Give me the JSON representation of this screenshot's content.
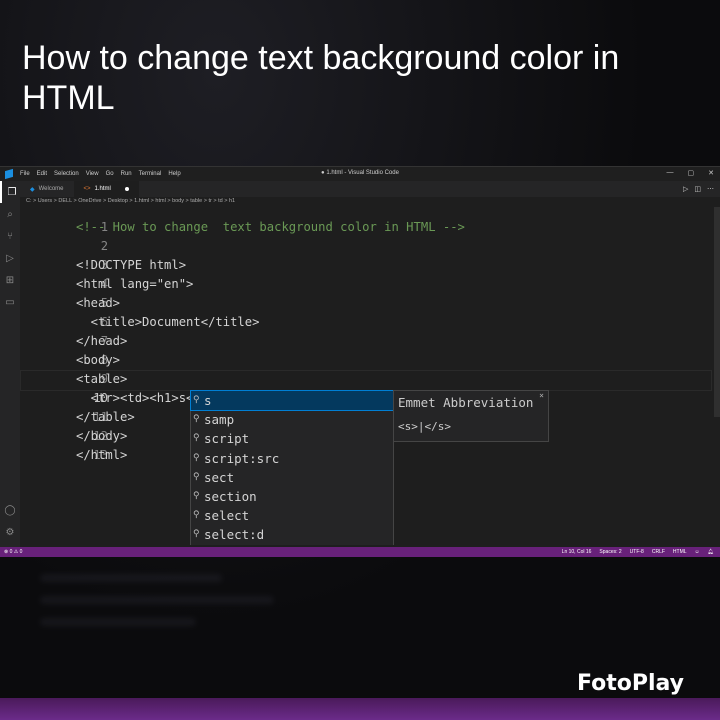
{
  "video": {
    "title": "How  to change text background color in HTML",
    "watermark": "FotoPlay"
  },
  "window": {
    "title": "● 1.html - Visual Studio Code",
    "menu": [
      "File",
      "Edit",
      "Selection",
      "View",
      "Go",
      "Run",
      "Terminal",
      "Help"
    ],
    "controls": [
      "—",
      "▢",
      "✕"
    ]
  },
  "tabs": [
    {
      "label": "Welcome",
      "icon": "vscode-icon"
    },
    {
      "label": "1.html",
      "icon": "html-icon",
      "modified": true
    }
  ],
  "breadcrumb": "C: > Users > DELL > OneDrive > Desktop > 1.html > html > body > table > tr > td > h1",
  "editor": {
    "current_line": 10,
    "lines": [
      {
        "n": "1",
        "text": "<!-- How to change  text background color in HTML -->"
      },
      {
        "n": "2",
        "text": ""
      },
      {
        "n": "3",
        "text": "<!DOCTYPE html>"
      },
      {
        "n": "4",
        "text": "<html lang=\"en\">"
      },
      {
        "n": "5",
        "text": "<head>"
      },
      {
        "n": "6",
        "text": "  <title>Document</title>"
      },
      {
        "n": "7",
        "text": "</head>"
      },
      {
        "n": "8",
        "text": "<body>"
      },
      {
        "n": "9",
        "text": "<table>"
      },
      {
        "n": "10",
        "text": "  <tr><td><h1>s</h1></td></tr>"
      },
      {
        "n": "11",
        "text": "</table>"
      },
      {
        "n": "12",
        "text": "</body>"
      },
      {
        "n": "13",
        "text": "</html>"
      }
    ]
  },
  "suggest": {
    "items": [
      "s",
      "samp",
      "script",
      "script:src",
      "sect",
      "section",
      "select",
      "select:d"
    ],
    "selected_index": 0
  },
  "details": {
    "header": "Emmet Abbreviation",
    "content": "<s>|</s>",
    "close": "×"
  },
  "statusbar": {
    "left": "⊗ 0 ⚠ 0",
    "position": "Ln 10, Col 16",
    "spaces": "Spaces: 2",
    "encoding": "UTF-8",
    "eol": "CRLF",
    "language": "HTML"
  },
  "colors": {
    "accent": "#007fd4",
    "statusbar": "#68217a",
    "editor_bg": "#1e1e1e"
  }
}
